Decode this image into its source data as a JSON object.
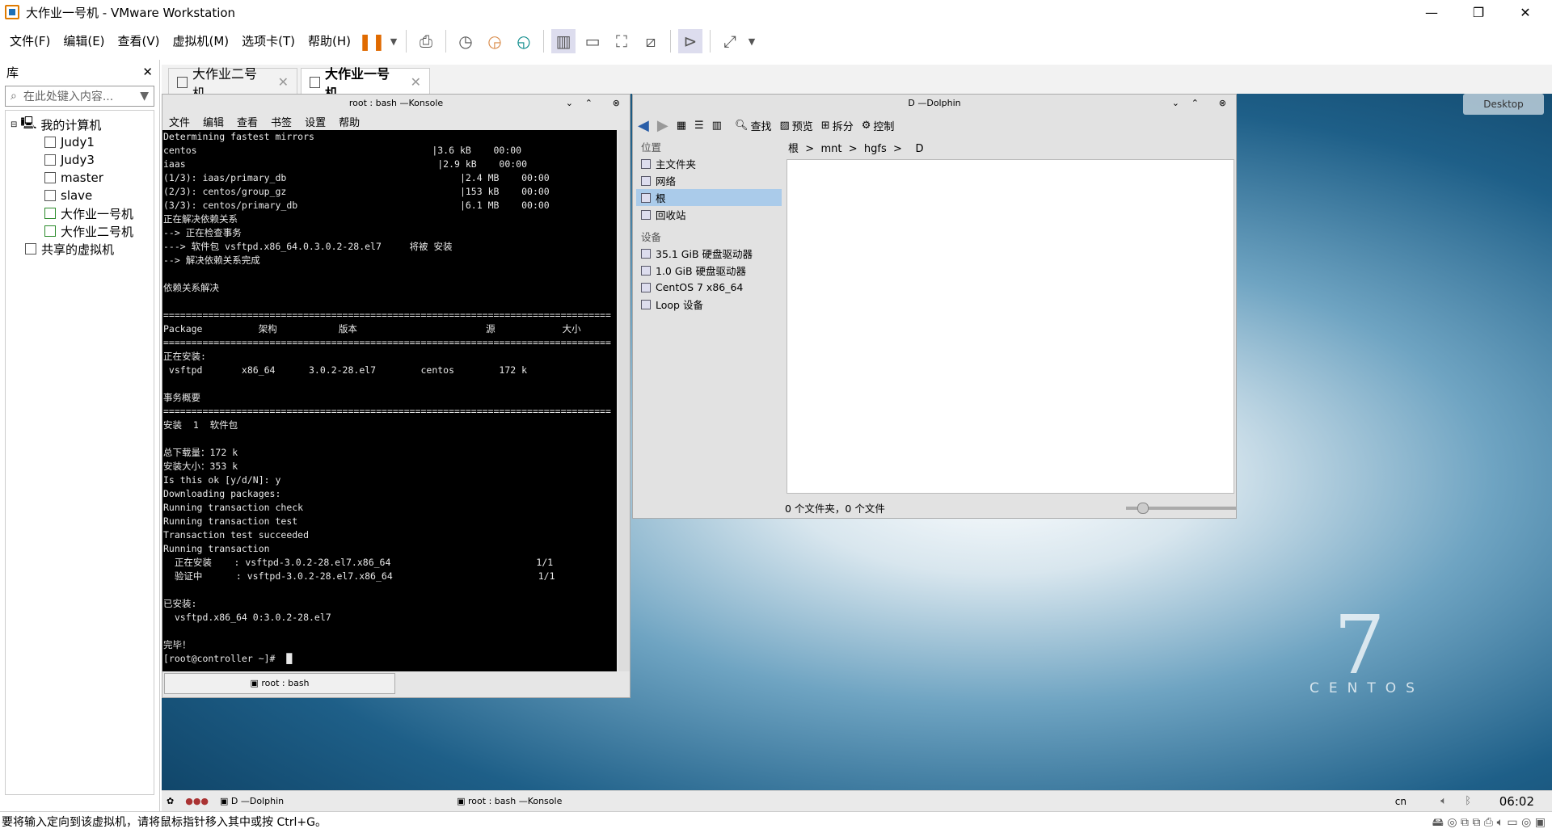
{
  "window": {
    "title": "大作业一号机 - VMware Workstation",
    "minimize": "—",
    "restore": "❐",
    "close": "✕"
  },
  "menu": [
    "文件(F)",
    "编辑(E)",
    "查看(V)",
    "虚拟机(M)",
    "选项卡(T)",
    "帮助(H)"
  ],
  "library": {
    "title": "库",
    "close": "✕",
    "search_placeholder": "在此处键入内容...",
    "root": "我的计算机",
    "vms": [
      "Judy1",
      "Judy3",
      "master",
      "slave",
      "大作业一号机",
      "大作业二号机"
    ],
    "shared": "共享的虚拟机"
  },
  "tabs": [
    {
      "label": "大作业二号机",
      "close": "✕"
    },
    {
      "label": "大作业一号机",
      "close": "✕"
    }
  ],
  "konsole": {
    "title": "root : bash —Konsole",
    "menu": [
      "文件",
      "编辑",
      "查看",
      "书签",
      "设置",
      "帮助"
    ],
    "tab": "root : bash",
    "lines": [
      "Determining fastest mirrors",
      "centos                                          |3.6 kB    00:00",
      "iaas                                             |2.9 kB    00:00",
      "(1/3): iaas/primary_db                               |2.4 MB    00:00",
      "(2/3): centos/group_gz                               |153 kB    00:00",
      "(3/3): centos/primary_db                             |6.1 MB    00:00",
      "正在解决依赖关系",
      "--> 正在检查事务",
      "---> 软件包 vsftpd.x86_64.0.3.0.2-28.el7     将被 安装",
      "--> 解决依赖关系完成",
      "",
      "依赖关系解决",
      "",
      "================================================================================",
      "Package          架构           版本                       源            大小",
      "================================================================================",
      "正在安装:",
      " vsftpd       x86_64      3.0.2-28.el7        centos        172 k",
      "",
      "事务概要",
      "================================================================================",
      "安装  1  软件包",
      "",
      "总下载量：172 k",
      "安装大小：353 k",
      "Is this ok [y/d/N]: y",
      "Downloading packages:",
      "Running transaction check",
      "Running transaction test",
      "Transaction test succeeded",
      "Running transaction",
      "  正在安装    : vsftpd-3.0.2-28.el7.x86_64                          1/1",
      "  验证中      : vsftpd-3.0.2-28.el7.x86_64                          1/1",
      "",
      "已安装:",
      "  vsftpd.x86_64 0:3.0.2-28.el7",
      "",
      "完毕！",
      "[root@controller ~]#  █"
    ]
  },
  "dolphin": {
    "title": "D —Dolphin",
    "toolbar": [
      "查找",
      "预览",
      "拆分",
      "控制"
    ],
    "places_header": "位置",
    "places": [
      "主文件夹",
      "网络",
      "根",
      "回收站"
    ],
    "devices_header": "设备",
    "devices": [
      "35.1 GiB 硬盘驱动器",
      "1.0 GiB 硬盘驱动器",
      "CentOS 7 x86_64",
      "Loop 设备"
    ],
    "breadcrumb": [
      "根",
      ">",
      "mnt",
      ">",
      "hgfs",
      ">",
      "D"
    ],
    "status": "0 个文件夹，0 个文件"
  },
  "desktop": {
    "button": "Desktop",
    "logo_number": "7",
    "logo_word": "CENTOS"
  },
  "guest_taskbar": {
    "items": [
      "D —Dolphin",
      "root : bash —Konsole"
    ],
    "clock": "06:02",
    "lang": "cn"
  },
  "statusbar": "要将输入定向到该虚拟机，请将鼠标指针移入其中或按 Ctrl+G。"
}
